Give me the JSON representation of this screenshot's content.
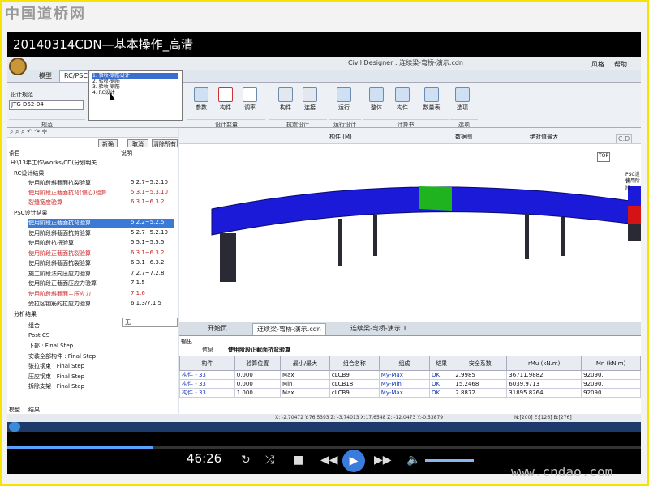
{
  "site_logo": "中国道桥网",
  "video_title": "20140314CDN—基本操作_高清",
  "app": {
    "title": "Civil Designer : 连续梁-弯桥-演示.cdn",
    "top_right": [
      "风格",
      "帮助"
    ],
    "tabs": [
      "模型",
      "RC/PSC"
    ],
    "spec_label": "设计规范",
    "spec_value": "JTG D62-04",
    "spec_group": "规范",
    "dropdown_items": [
      "1. 验收-钢筋设计",
      "2. 验收-钢筋",
      "3. 验收-钢筋",
      "4. RC设计"
    ],
    "ribbon_buttons": [
      "参数",
      "构件",
      "调率",
      "构件",
      "连接",
      "运行",
      "整体",
      "构件",
      "数量表",
      "选项"
    ],
    "ribbon_groups": [
      "设计变量",
      "抗震设计",
      "运行设计",
      "计算书",
      "选项"
    ],
    "left_buttons": [
      "新确",
      "取消",
      "清除所有"
    ],
    "left_header": [
      "条目",
      "说明"
    ],
    "tree_root": "H:\\13年工作\\works\\CD(分划明关...",
    "rc_group": "RC设计结果",
    "rc_items": [
      {
        "label": "使用阶段斜截面抗裂验算",
        "ref": "5.2.7~5.2.10",
        "red": false
      },
      {
        "label": "使用阶段正截面抗弯(偏心)验算",
        "ref": "5.3.1~5.3.10",
        "red": true
      },
      {
        "label": "裂缝宽度验算",
        "ref": "6.3.1~6.3.2",
        "red": true
      }
    ],
    "psc_group": "PSC设计结果",
    "psc_items": [
      {
        "label": "使用阶段正截面抗弯验算",
        "ref": "5.2.2~5.2.5",
        "red": false,
        "selected": true
      },
      {
        "label": "使用阶段斜截面抗剪验算",
        "ref": "5.2.7~5.2.10",
        "red": false
      },
      {
        "label": "使用阶段抗扭验算",
        "ref": "5.5.1~5.5.5",
        "red": false
      },
      {
        "label": "使用阶段正截面抗裂验算",
        "ref": "6.3.1~6.3.2",
        "red": true
      },
      {
        "label": "使用阶段斜截面抗裂验算",
        "ref": "6.3.1~6.3.2",
        "red": false
      },
      {
        "label": "施工阶段法向压应力验算",
        "ref": "7.2.7~7.2.8",
        "red": false
      },
      {
        "label": "使用阶段正截面压应力验算",
        "ref": "7.1.5",
        "red": false
      },
      {
        "label": "使用阶段斜截面主压应力",
        "ref": "7.1.6",
        "red": true
      },
      {
        "label": "受拉区钢筋的拉应力验算",
        "ref": "6.1.3/7.1.5",
        "red": false
      }
    ],
    "analysis_group": "分析结果",
    "analysis_items": [
      "组合",
      "Post CS",
      "下部 : Final Step",
      "安装全部构件 : Final Step",
      "张拉钢束 : Final Step",
      "压应钢束 : Final Step",
      "拆除支架 : Final Step"
    ],
    "combo_value": "无",
    "bottom_tabs": [
      "模型",
      "结果"
    ],
    "viewport_toolbar": [
      "构件 (M)",
      "数据图",
      "绝对值最大"
    ],
    "legend_text": [
      "PSC设计",
      "使用阶段"
    ],
    "view_cube_label": "TOP",
    "cdot_label": "C.D",
    "doc_tabs": [
      "开始页",
      "连续梁-弯桥-演示.cdn",
      "连续梁-弯桥-演示.1"
    ],
    "output_label": "输出",
    "output_tabs": [
      "信息",
      "使用阶段正截面抗弯验算"
    ],
    "table_headers": [
      "构件",
      "验算位置",
      "最小/最大",
      "组合名称",
      "组成",
      "结果",
      "安全系数",
      "rMu (kN.m)",
      "Mn (kN.m)"
    ],
    "table_rows": [
      [
        "构件 - 33",
        "0.000",
        "Max",
        "cLCB9",
        "My-Max",
        "OK",
        "2.9985",
        "36711.9882",
        "92090."
      ],
      [
        "构件 - 33",
        "0.000",
        "Min",
        "cLCB18",
        "My-Min",
        "OK",
        "15.2468",
        "6039.9713",
        "92090."
      ],
      [
        "构件 - 33",
        "1.000",
        "Max",
        "cLCB9",
        "My-Max",
        "OK",
        "2.8872",
        "31895.8264",
        "92090."
      ]
    ],
    "status_coords": "X: -2.70472  Y:76.5393  Z: -3.74013  X:17.6548  Z: -12.0473  Y:-0.53879",
    "status_right": "N:[200] E:[126] B:[276]"
  },
  "player": {
    "time": "46:26",
    "watermark": "www.cndao.com"
  },
  "colors": {
    "beam": "#1a1ad8",
    "beam_highlight": "#1fb41f",
    "pier": "#2a2a35",
    "legend_red": "#d41414"
  }
}
